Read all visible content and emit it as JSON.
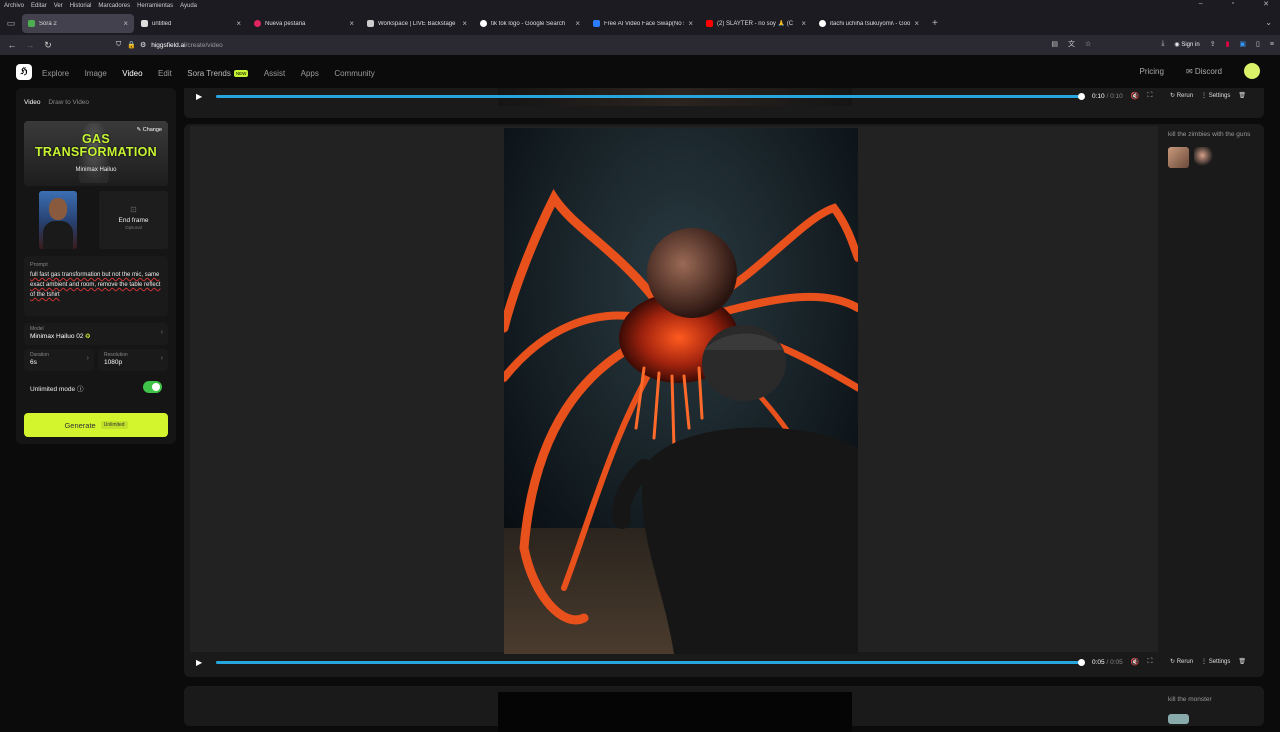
{
  "os_menu": [
    "Archivo",
    "Editar",
    "Ver",
    "Historial",
    "Marcadores",
    "Herramientas",
    "Ayuda"
  ],
  "tabs": [
    {
      "title": "Sora 2",
      "color": "#4caf50",
      "active": true
    },
    {
      "title": "untitled",
      "color": "#dddddd",
      "active": false
    },
    {
      "title": "Nueva pestaña",
      "color": "#e0245e",
      "active": false
    },
    {
      "title": "Workspace | LIVE Backstage",
      "color": "#cccccc",
      "active": false
    },
    {
      "title": "tik tok logo - Google Search",
      "color": "#ffffff",
      "active": false
    },
    {
      "title": "Free AI Video Face Swap(No si",
      "color": "#2b7cff",
      "active": false
    },
    {
      "title": "(2) SLAYTER - no soy 🙏 (C",
      "color": "#ff0000",
      "active": false
    },
    {
      "title": "itachi uchiha tsukuyomi\\ - Goo",
      "color": "#ffffff",
      "active": false
    }
  ],
  "url": {
    "domain": "higgsfield.ai",
    "path": "/create/video"
  },
  "browser": {
    "sign_in": "Sign in"
  },
  "nav": {
    "items": [
      "Explore",
      "Image",
      "Video",
      "Edit",
      "Sora Trends",
      "Assist",
      "Apps",
      "Community"
    ],
    "new_badge": "NEW",
    "pricing": "Pricing",
    "discord": "Discord"
  },
  "panel": {
    "tab_video": "Video",
    "tab_draw": "Draw to Video",
    "preset_title": "GAS TRANSFORMATION",
    "preset_sub": "Minimax Hailuo",
    "change": "Change",
    "end_frame": "End frame",
    "optional": "Optional",
    "prompt_label": "Prompt",
    "prompt_text": "full fast gas transformation but not the mic, same exact ambient and room, remove the table reflect of the tshirt",
    "model_label": "Model",
    "model_value": "Minimax Hailuo 02",
    "duration_label": "Duration",
    "duration_value": "6s",
    "resolution_label": "Resolution",
    "resolution_value": "1080p",
    "unlimited_label": "Unlimited mode",
    "unlimited_on": true,
    "generate": "Generate",
    "unlimited_badge": "Unlimited"
  },
  "top_player": {
    "current": "0:10",
    "duration": "0:10",
    "progress": 1.0
  },
  "main_player": {
    "current": "0:05",
    "duration": "0:05",
    "progress": 1.0
  },
  "actions": {
    "rerun": "Rerun",
    "settings": "Settings"
  },
  "side": {
    "prompt": "kill the zimbies with the guns"
  },
  "next_card": {
    "prompt": "kill the monster"
  },
  "colors": {
    "accent": "#d2f52e",
    "progress": "#27a6dd",
    "toggle": "#3fc34a"
  }
}
